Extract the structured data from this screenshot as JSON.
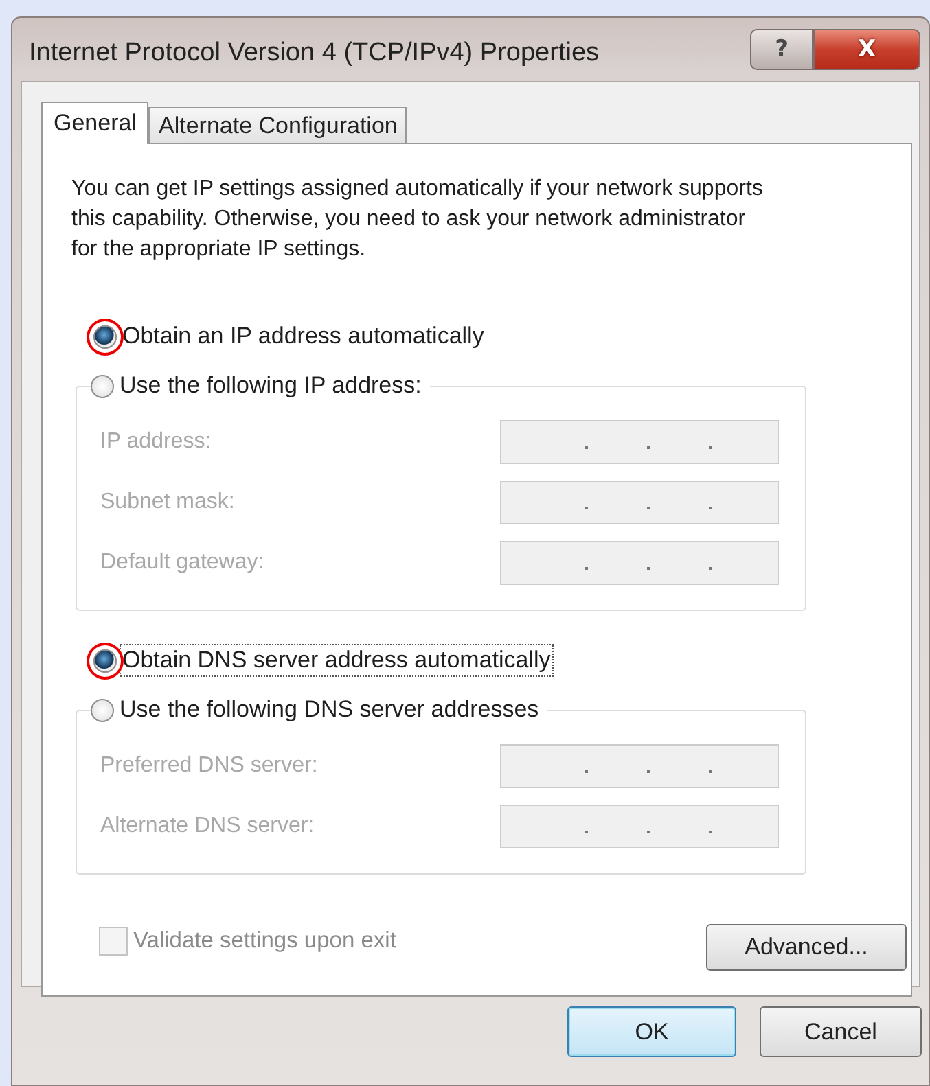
{
  "window": {
    "title": "Internet Protocol Version 4 (TCP/IPv4) Properties",
    "help_button": "?",
    "close_button": "X"
  },
  "tabs": [
    {
      "label": "General",
      "selected": true
    },
    {
      "label": "Alternate Configuration",
      "selected": false
    }
  ],
  "description": "You can get IP settings assigned automatically if your network supports this capability. Otherwise, you need to ask your network administrator for the appropriate IP settings.",
  "sections": [
    {
      "auto_option": {
        "label": "Obtain an IP address automatically",
        "selected": true,
        "highlighted": true,
        "focused": false
      },
      "manual_option": {
        "label": "Use the following IP address:",
        "selected": false,
        "highlighted": false
      },
      "fields": [
        {
          "label": "IP address:",
          "disabled": true
        },
        {
          "label": "Subnet mask:",
          "disabled": true
        },
        {
          "label": "Default gateway:",
          "disabled": true
        }
      ]
    },
    {
      "auto_option": {
        "label": "Obtain DNS server address automatically",
        "selected": true,
        "highlighted": true,
        "focused": true
      },
      "manual_option": {
        "label": "Use the following DNS server addresses",
        "selected": false,
        "highlighted": false
      },
      "fields": [
        {
          "label": "Preferred DNS server:",
          "disabled": true
        },
        {
          "label": "Alternate DNS server:",
          "disabled": true
        }
      ]
    }
  ],
  "validate_checkbox": {
    "label": "Validate settings upon exit",
    "checked": false,
    "disabled": true
  },
  "advanced_button": "Advanced...",
  "buttons": [
    {
      "label": "OK",
      "kind": "default"
    },
    {
      "label": "Cancel",
      "kind": "normal"
    }
  ]
}
